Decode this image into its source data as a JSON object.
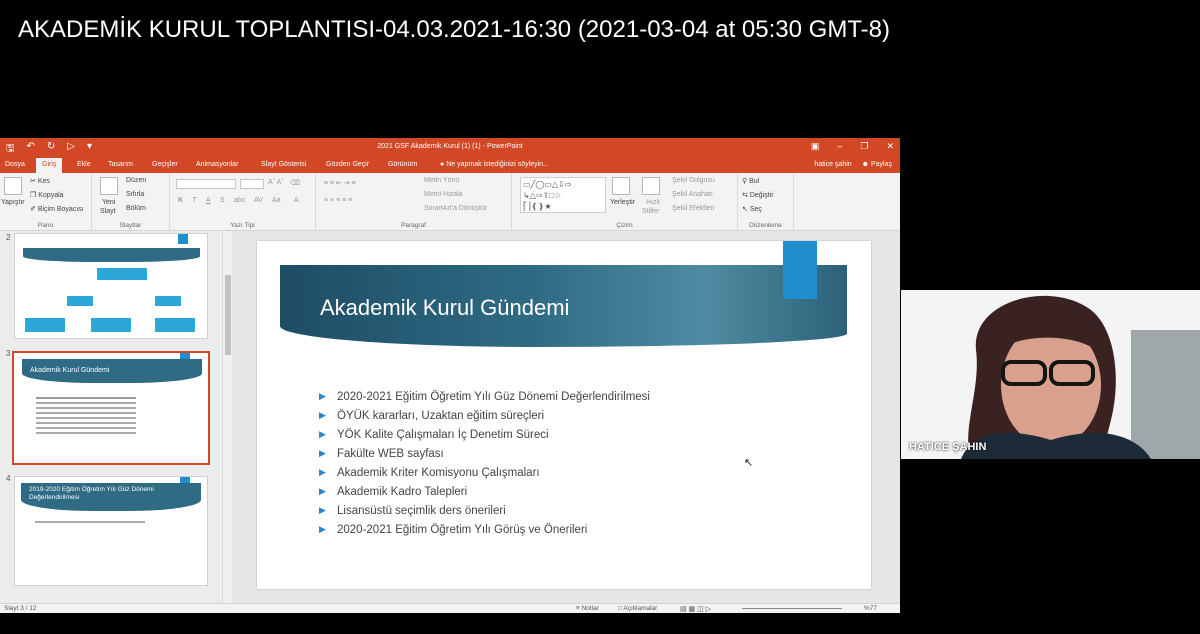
{
  "video_title": "AKADEMİK KURUL TOPLANTISI-04.03.2021-16:30 (2021-03-04 at 05:30 GMT-8)",
  "powerpoint": {
    "window_title": "2021 GSF Akademik Kurul (1) (1) - PowerPoint",
    "tabs": [
      {
        "label": "Dosya"
      },
      {
        "label": "Giriş"
      },
      {
        "label": "Ekle"
      },
      {
        "label": "Tasarım"
      },
      {
        "label": "Geçişler"
      },
      {
        "label": "Animasyonlar"
      },
      {
        "label": "Slayt Gösterisi"
      },
      {
        "label": "Gözden Geçir"
      },
      {
        "label": "Görünüm"
      }
    ],
    "tell_me": "Ne yapmak istediğinizi söyleyin...",
    "user": "hatice şahin",
    "share": "Paylaş",
    "ribbon": {
      "clipboard": {
        "paste": "Yapıştır",
        "cut": "Kes",
        "copy": "Kopyala",
        "format_painter": "Biçim Boyacısı",
        "label": "Pano"
      },
      "slides": {
        "new_slide_1": "Yeni",
        "new_slide_2": "Slayt",
        "layout": "Düzen",
        "reset": "Sıfırla",
        "section": "Bölüm",
        "label": "Slaytlar"
      },
      "font": {
        "label": "Yazı Tipi"
      },
      "paragraph": {
        "text_direction": "Metin Yönü",
        "align_text": "Metni Hizala",
        "smartart": "SmartArt'a Dönüştür",
        "label": "Paragraf"
      },
      "drawing": {
        "arrange": "Yerleştir",
        "quick_styles_1": "Hızlı",
        "quick_styles_2": "Stiller",
        "shape_fill": "Şekil Dolgusu",
        "shape_outline": "Şekil Anahatı",
        "shape_effects": "Şekil Efektleri",
        "label": "Çizim"
      },
      "editing": {
        "find": "Bul",
        "replace": "Değiştir",
        "select": "Seç",
        "label": "Düzenleme"
      }
    },
    "thumbnails": [
      {
        "number": "2"
      },
      {
        "number": "3",
        "title": "Akademik Kurul Gündemi"
      },
      {
        "number": "4",
        "title": "2019-2020 Eğitim Öğretim Yılı Güz Dönemi Değerlendirilmesi"
      }
    ],
    "slide": {
      "title": "Akademik Kurul Gündemi",
      "bullets": [
        "2020-2021 Eğitim Öğretim Yılı Güz Dönemi Değerlendirilmesi",
        "ÖYÜK kararları, Uzaktan eğitim süreçleri",
        "YÖK Kalite Çalışmaları İç Denetim Süreci",
        "Fakülte WEB sayfası",
        "Akademik Kriter Komisyonu Çalışmaları",
        "Akademik Kadro Talepleri",
        "Lisansüstü seçimlik ders önerileri",
        "2020-2021 Eğitim Öğretim Yılı Görüş ve Önerileri"
      ]
    },
    "status": {
      "slide_counter": "Slayt 3 / 12",
      "notes": "Notlar",
      "comments": "Açıklamalar",
      "zoom": "%77"
    }
  },
  "webcam": {
    "participant_name": "HATICE ŞAHIN"
  },
  "colors": {
    "ppt_accent": "#d24726",
    "slide_banner": "#2f6b84",
    "slide_accent": "#1e8ecf",
    "bullet": "#2a86c8"
  }
}
